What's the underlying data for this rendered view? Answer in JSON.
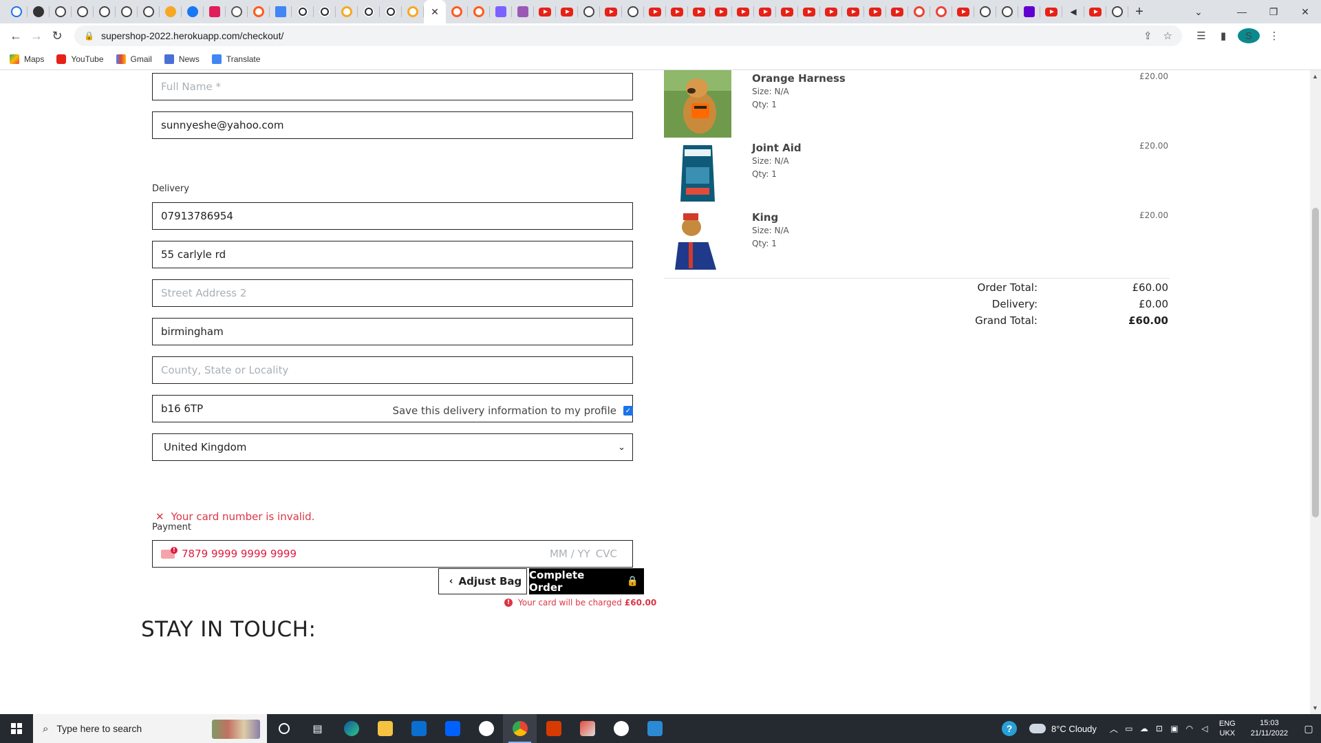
{
  "browser": {
    "address": "supershop-2022.herokuapp.com/checkout/",
    "profile_initial": "S",
    "bookmarks": [
      "Maps",
      "YouTube",
      "Gmail",
      "News",
      "Translate"
    ]
  },
  "form": {
    "full_name_placeholder": "Full Name *",
    "email_value": "sunnyeshe@yahoo.com",
    "delivery_label": "Delivery",
    "phone_value": "07913786954",
    "street1_value": "55 carlyle rd",
    "street2_placeholder": "Street Address 2",
    "town_value": "birmingham",
    "county_placeholder": "County, State or Locality",
    "postcode_value": "b16 6TP",
    "country_value": "United Kingdom",
    "save_info_label": "Save this delivery information to my profile",
    "payment_label": "Payment",
    "card_number": "7879 9999 9999 9999",
    "card_expiry_placeholder": "MM / YY",
    "card_cvc_placeholder": "CVC",
    "card_error": "Your card number is invalid.",
    "adjust_bag_label": "Adjust Bag",
    "complete_order_label": "Complete Order",
    "charge_note": "Your card will be charged",
    "charge_amount": "£60.00"
  },
  "footer": {
    "stay_in_touch": "STAY IN TOUCH:"
  },
  "order": {
    "items": [
      {
        "name": "Orange Harness",
        "size": "Size: N/A",
        "qty": "Qty: 1",
        "price": "£20.00"
      },
      {
        "name": "Joint Aid",
        "size": "Size: N/A",
        "qty": "Qty: 1",
        "price": "£20.00"
      },
      {
        "name": "King",
        "size": "Size: N/A",
        "qty": "Qty: 1",
        "price": "£20.00"
      }
    ],
    "order_total_label": "Order Total:",
    "order_total": "£60.00",
    "delivery_label": "Delivery:",
    "delivery": "£0.00",
    "grand_total_label": "Grand Total:",
    "grand_total": "£60.00"
  },
  "taskbar": {
    "search_placeholder": "Type here to search",
    "weather": "8°C  Cloudy",
    "lang_top": "ENG",
    "lang_bottom": "UKX",
    "time": "15:03",
    "date": "21/11/2022"
  },
  "colors": {
    "error": "#dc3545",
    "card_error": "#df1b41",
    "checkbox": "#1a73e8",
    "primary_button": "#000000"
  }
}
